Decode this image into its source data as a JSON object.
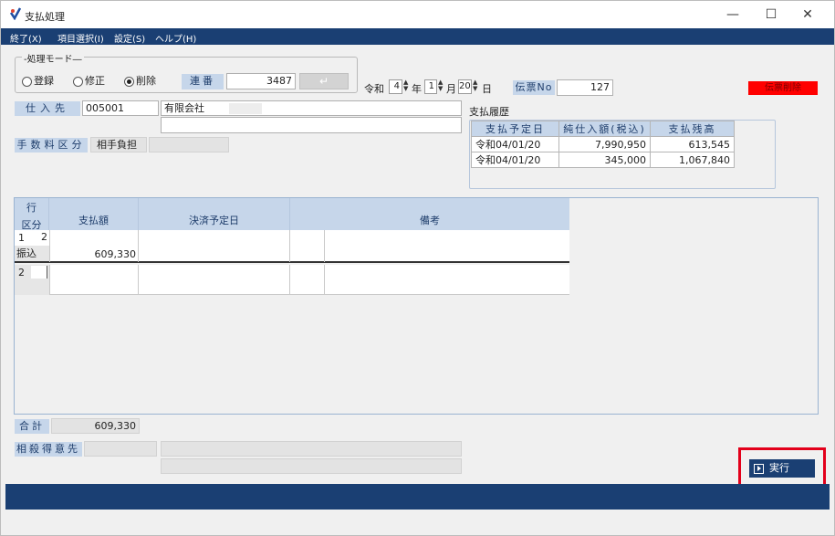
{
  "window": {
    "title": "支払処理",
    "minimize": "—",
    "maximize": "☐",
    "close": "✕"
  },
  "menu": [
    "終了(X)",
    "項目選択(I)",
    "設定(S)",
    "ヘルプ(H)"
  ],
  "mode": {
    "legend": "処理モード",
    "options": [
      "登録",
      "修正",
      "削除"
    ],
    "selected": "削除"
  },
  "renban": {
    "label": "連番",
    "value": "3487"
  },
  "date": {
    "era": "令和",
    "year": "4",
    "year_unit": "年",
    "month": "1",
    "month_unit": "月",
    "day": "20",
    "day_unit": "日"
  },
  "slip": {
    "label": "伝票No",
    "value": "127",
    "status": "伝票削除"
  },
  "supplier": {
    "label": "仕入先",
    "code": "005001",
    "name": "有限会社"
  },
  "fee": {
    "label": "手数料区分",
    "value": "相手負担"
  },
  "history": {
    "title": "支払履歴",
    "columns": [
      "支払予定日",
      "純仕入額(税込)",
      "支払残高"
    ],
    "rows": [
      [
        "令和04/01/20",
        "7,990,950",
        "613,545"
      ],
      [
        "令和04/01/20",
        "345,000",
        "1,067,840"
      ]
    ]
  },
  "grid": {
    "head1": "行",
    "columns": [
      "区分",
      "支払額",
      "決済予定日",
      "備考"
    ],
    "rows": [
      {
        "no": "1",
        "code": "2",
        "kubun": "振込",
        "amount": "609,330"
      },
      {
        "no": "2",
        "code": "",
        "kubun": "",
        "amount": ""
      }
    ]
  },
  "total": {
    "label": "合計",
    "value": "609,330"
  },
  "offset": {
    "label": "相殺得意先"
  },
  "execute": {
    "label": "実行"
  }
}
